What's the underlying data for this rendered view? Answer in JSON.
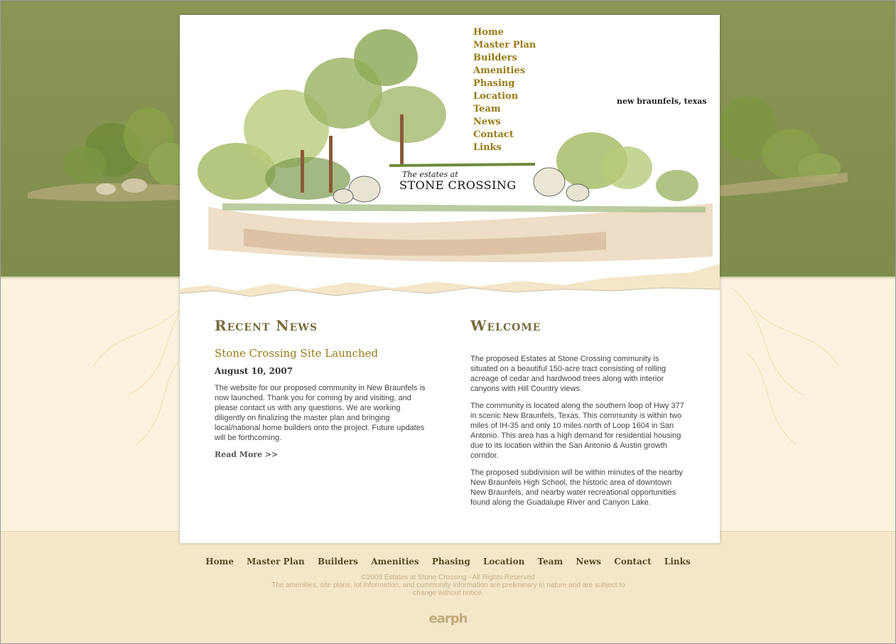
{
  "header": {
    "tagline": "new braunfels, texas",
    "sign_small": "The estates at",
    "sign_big": "STONE CROSSING",
    "nav": [
      "Home",
      "Master Plan",
      "Builders",
      "Amenities",
      "Phasing",
      "Location",
      "Team",
      "News",
      "Contact",
      "Links"
    ]
  },
  "news": {
    "heading": "Recent News",
    "title": "Stone Crossing Site Launched",
    "date": "August 10, 2007",
    "body": "The website for our proposed community in New Braunfels is now launched. Thank you for coming by and visiting, and please contact us with any questions. We are working diligently on finalizing the master plan and bringing local/national home builders onto the project. Future updates will be forthcoming.",
    "read_more": "Read More >>"
  },
  "welcome": {
    "heading": "Welcome",
    "p1": "The proposed Estates at Stone Crossing community is situated on a beautiful 150-acre tract consisting of rolling acreage of cedar and hardwood trees along with interior canyons with Hill Country views.",
    "p2": "The community is located along the southern loop of Hwy 377 in scenic New Braunfels, Texas. This community is within two miles of IH-35 and only 10 miles north of Loop 1604 in San Antonio. This area has a high demand for residential housing due to its location within the San Antonio & Austin growth corridor.",
    "p3": "The proposed subdivision will be within minutes of the nearby New Braunfels High School, the historic area of downtown New Braunfels, and nearby water recreational opportunities found along the Guadalupe River and Canyon Lake."
  },
  "footer": {
    "nav": [
      "Home",
      "Master Plan",
      "Builders",
      "Amenities",
      "Phasing",
      "Location",
      "Team",
      "News",
      "Contact",
      "Links"
    ],
    "copyright": "©2008 Estates at Stone Crossing - All Rights Reserved",
    "disclaimer": "The amenities, site plans, lot information, and community information are preliminary in nature and are subject to change without notice.",
    "credit": "earph"
  },
  "colors": {
    "green_band": "#8a9656",
    "cream_band": "#fbf2e0",
    "footer_bg": "#f3e6c9",
    "nav_gold": "#9a7a16",
    "heading_brown": "#7a6b3e"
  }
}
